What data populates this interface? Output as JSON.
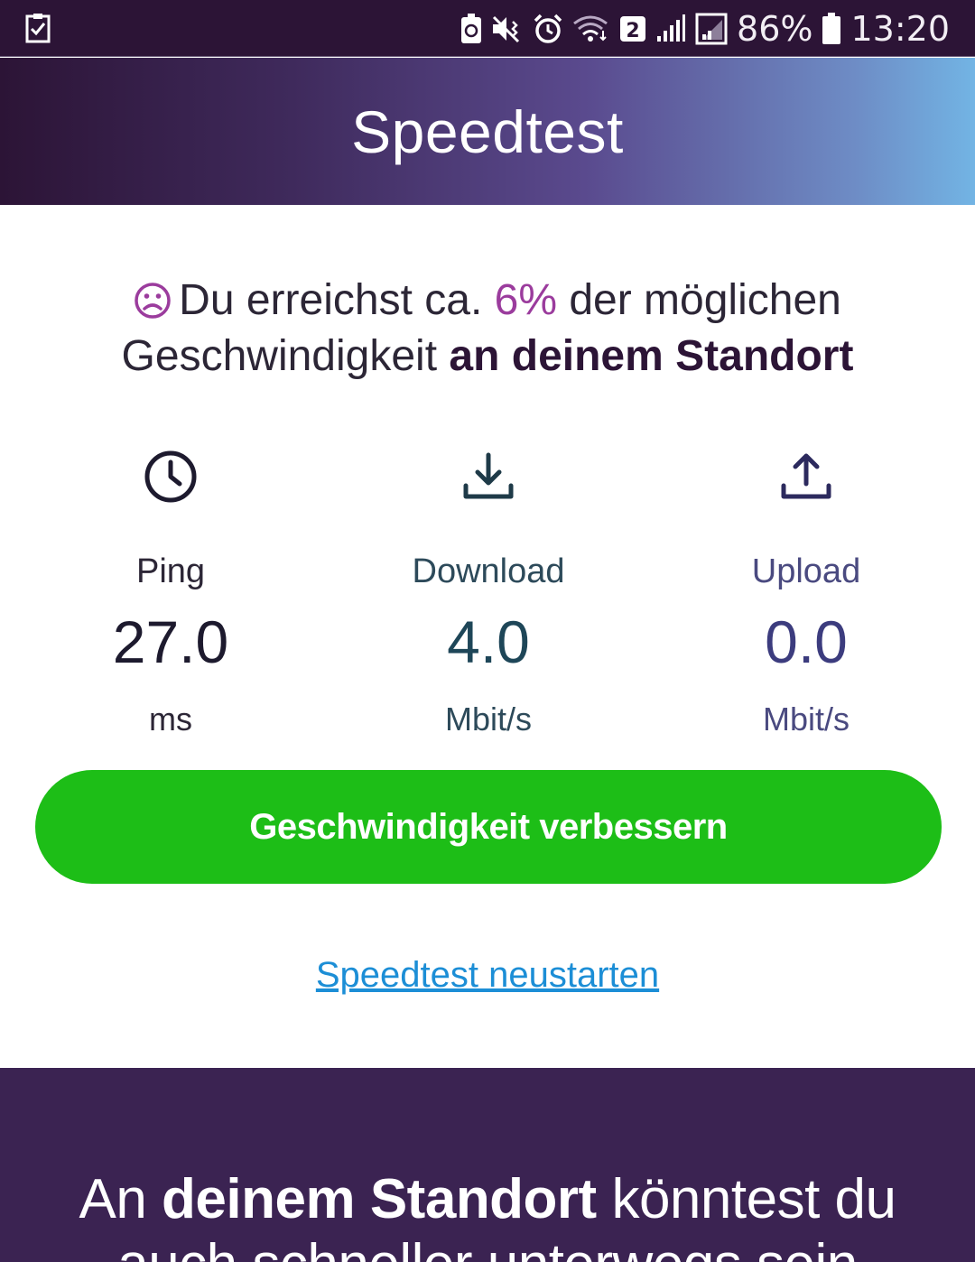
{
  "status_bar": {
    "battery": "86%",
    "time": "13:20",
    "sim_badge": "2",
    "icons": [
      "checklist-icon",
      "recycle-battery-icon",
      "mute-vibrate-icon",
      "alarm-icon",
      "wifi-icon",
      "sim-2-icon",
      "signal-icon",
      "signal-box-icon",
      "battery-icon"
    ]
  },
  "header": {
    "title": "Speedtest"
  },
  "result": {
    "icon": "sad-face-icon",
    "text_before": "Du erreichst ca.",
    "percent": "6%",
    "text_middle": "der möglichen Geschwindigkeit",
    "text_bold": "an deinem Standort",
    "percent_value": 6
  },
  "metrics": {
    "ping": {
      "icon": "clock-icon",
      "label": "Ping",
      "value": "27.0",
      "unit": "ms"
    },
    "download": {
      "icon": "download-icon",
      "label": "Download",
      "value": "4.0",
      "unit": "Mbit/s"
    },
    "upload": {
      "icon": "upload-icon",
      "label": "Upload",
      "value": "0.0",
      "unit": "Mbit/s"
    }
  },
  "actions": {
    "improve_label": "Geschwindigkeit verbessern",
    "restart_label": "Speedtest neustarten"
  },
  "promo": {
    "prefix": "An",
    "bold": "deinem Standort",
    "suffix": "könntest du",
    "line2": "auch schneller unterwegs sein"
  },
  "colors": {
    "status_bar_bg": "#2c1436",
    "button_green": "#1dbe17",
    "link_blue": "#1c8ed6",
    "accent_purple": "#9b3c9d",
    "promo_bg": "#3b2352"
  }
}
